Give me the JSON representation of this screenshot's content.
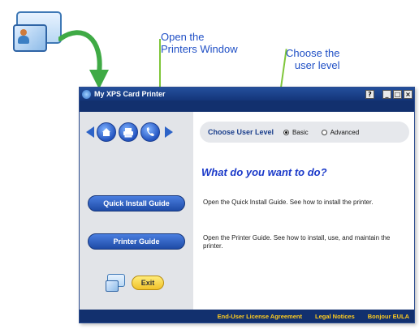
{
  "callouts": {
    "printers": "Open the\nPrinters Window",
    "level": "Choose the\nuser level"
  },
  "window": {
    "title": "My XPS Card Printer",
    "buttons": {
      "help": "?",
      "minimize": "_",
      "maximize": "□",
      "close": "×"
    }
  },
  "nav": {
    "icons": [
      "back-arrow-icon",
      "home-icon",
      "printer-icon",
      "phone-icon",
      "forward-arrow-icon"
    ]
  },
  "user_level": {
    "label": "Choose User Level",
    "options": [
      "Basic",
      "Advanced"
    ],
    "selected": "Basic"
  },
  "main": {
    "heading": "What do you want to do?",
    "quick_install_desc": "Open the Quick Install Guide. See how to install the printer.",
    "printer_guide_desc": "Open the Printer Guide. See how to install, use, and maintain the printer."
  },
  "sidebar": {
    "quick_install_label": "Quick Install Guide",
    "printer_guide_label": "Printer Guide",
    "exit_label": "Exit"
  },
  "footer": {
    "links": [
      "End-User License Agreement",
      "Legal Notices",
      "Bonjour EULA"
    ]
  },
  "colors": {
    "accent": "#2d63c7",
    "callout_text": "#1f4fc5",
    "callout_line": "#7fc63a",
    "heading": "#1a39c9",
    "footer_link": "#ffcc1f",
    "dark_banner": "#12306e"
  }
}
